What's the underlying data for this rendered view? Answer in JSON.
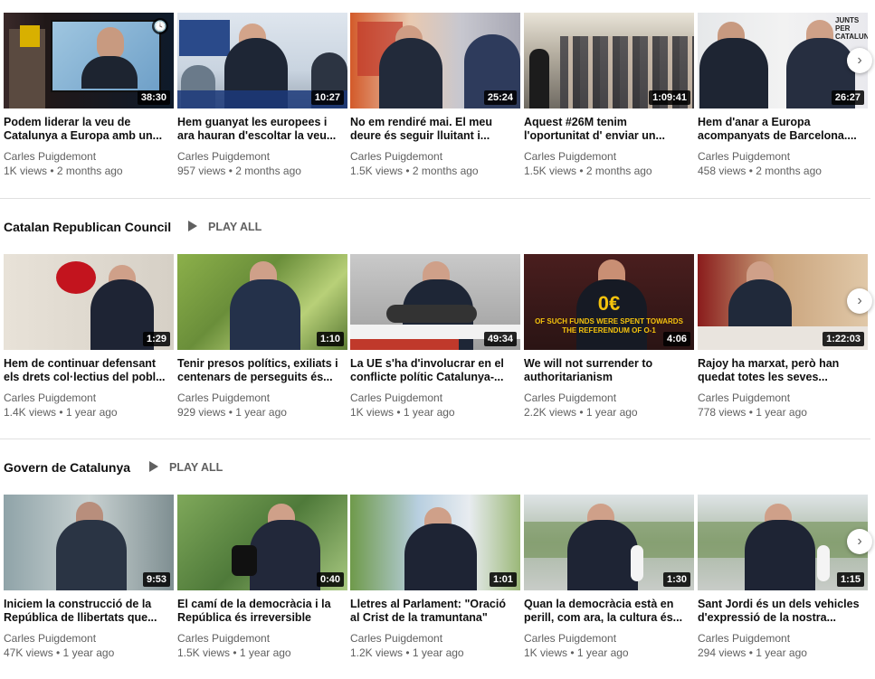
{
  "rows": [
    {
      "videos": [
        {
          "title": "Podem liderar la veu de Catalunya a Europa amb un...",
          "channel": "Carles Puigdemont",
          "meta": "1K views • 2 months ago",
          "duration": "38:30"
        },
        {
          "title": "Hem guanyat les europees i ara hauran d'escoltar la veu...",
          "channel": "Carles Puigdemont",
          "meta": "957 views • 2 months ago",
          "duration": "10:27"
        },
        {
          "title": "No em rendiré mai. El meu deure és seguir lluitant i...",
          "channel": "Carles Puigdemont",
          "meta": "1.5K views • 2 months ago",
          "duration": "25:24"
        },
        {
          "title": "Aquest #26M tenim l'oportunitat d' enviar un...",
          "channel": "Carles Puigdemont",
          "meta": "1.5K views • 2 months ago",
          "duration": "1:09:41"
        },
        {
          "title": "Hem d'anar a Europa acompanyats de Barcelona....",
          "channel": "Carles Puigdemont",
          "meta": "458 views • 2 months ago",
          "duration": "26:27"
        }
      ]
    },
    {
      "shelf_title": "Catalan Republican Council",
      "play_all": "PLAY ALL",
      "videos": [
        {
          "title": "Hem de continuar defensant els drets col·lectius del pobl...",
          "channel": "Carles Puigdemont",
          "meta": "1.4K views • 1 year ago",
          "duration": "1:29"
        },
        {
          "title": "Tenir presos polítics, exiliats i centenars de perseguits és...",
          "channel": "Carles Puigdemont",
          "meta": "929 views • 1 year ago",
          "duration": "1:10"
        },
        {
          "title": "La UE s'ha d'involucrar en el conflicte polític Catalunya-...",
          "channel": "Carles Puigdemont",
          "meta": "1K views • 1 year ago",
          "duration": "49:34"
        },
        {
          "title": "We will not surrender to authoritarianism",
          "channel": "Carles Puigdemont",
          "meta": "2.2K views • 1 year ago",
          "duration": "4:06"
        },
        {
          "title": "Rajoy ha marxat, però han quedat totes les seves...",
          "channel": "Carles Puigdemont",
          "meta": "778 views • 1 year ago",
          "duration": "1:22:03"
        }
      ]
    },
    {
      "shelf_title": "Govern de Catalunya",
      "play_all": "PLAY ALL",
      "videos": [
        {
          "title": "Iniciem la construcció de la República de llibertats que...",
          "channel": "Carles Puigdemont",
          "meta": "47K views • 1 year ago",
          "duration": "9:53"
        },
        {
          "title": "El camí de la democràcia i la República és irreversible",
          "channel": "Carles Puigdemont",
          "meta": "1.5K views • 1 year ago",
          "duration": "0:40"
        },
        {
          "title": "Lletres al Parlament: \"Oració al Crist de la tramuntana\"",
          "channel": "Carles Puigdemont",
          "meta": "1.2K views • 1 year ago",
          "duration": "1:01"
        },
        {
          "title": "Quan la democràcia està en perill, com ara, la cultura és...",
          "channel": "Carles Puigdemont",
          "meta": "1K views • 1 year ago",
          "duration": "1:30"
        },
        {
          "title": "Sant Jordi és un dels vehicles d'expressió de la nostra...",
          "channel": "Carles Puigdemont",
          "meta": "294 views • 1 year ago",
          "duration": "1:15"
        }
      ]
    }
  ],
  "thumbnail_text": {
    "juntx": "JUNTS PER CATALUNYA",
    "ocero": "0€",
    "funds": "OF SUCH FUNDS WERE SPENT TOWARDS THE REFERENDUM OF O-1"
  },
  "icons": {
    "next": "chevron-right-icon",
    "clock": "watch-later-icon",
    "play": "play-icon"
  },
  "colors": {
    "meta_text": "#606060",
    "duration_bg": "#000000",
    "divider": "#e0e0e0"
  }
}
